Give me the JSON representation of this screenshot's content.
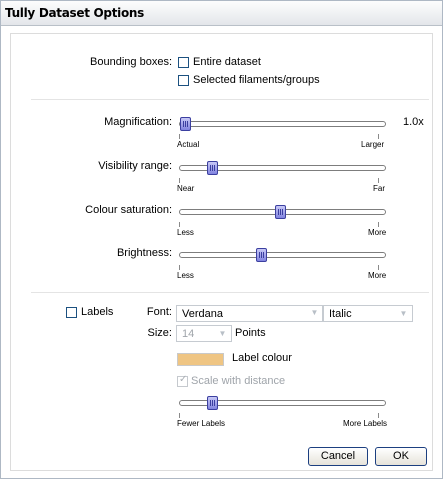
{
  "window": {
    "title": "Tully Dataset Options"
  },
  "bounding": {
    "label": "Bounding boxes:",
    "entire_dataset": {
      "label": "Entire dataset",
      "checked": false
    },
    "selected": {
      "label": "Selected filaments/groups",
      "checked": false
    }
  },
  "sliders": {
    "magnification": {
      "label": "Magnification:",
      "min_label": "Actual",
      "max_label": "Larger",
      "value_text": "1.0x",
      "fraction": 0.0
    },
    "visibility": {
      "label": "Visibility range:",
      "min_label": "Near",
      "max_label": "Far",
      "fraction": 0.14
    },
    "saturation": {
      "label": "Colour saturation:",
      "min_label": "Less",
      "max_label": "More",
      "fraction": 0.49
    },
    "brightness": {
      "label": "Brightness:",
      "min_label": "Less",
      "max_label": "More",
      "fraction": 0.39
    }
  },
  "labels": {
    "checkbox_label": "Labels",
    "checked": false,
    "font_label": "Font:",
    "font_value": "Verdana",
    "style_value": "Italic",
    "size_label": "Size:",
    "size_value": "14",
    "size_unit": "Points",
    "colour_label": "Label colour",
    "label_colour": "#efc583",
    "scale_label": "Scale with distance",
    "scale_checked": true,
    "density": {
      "min_label": "Fewer Labels",
      "max_label": "More Labels",
      "fraction": 0.14
    }
  },
  "buttons": {
    "cancel": "Cancel",
    "ok": "OK"
  }
}
